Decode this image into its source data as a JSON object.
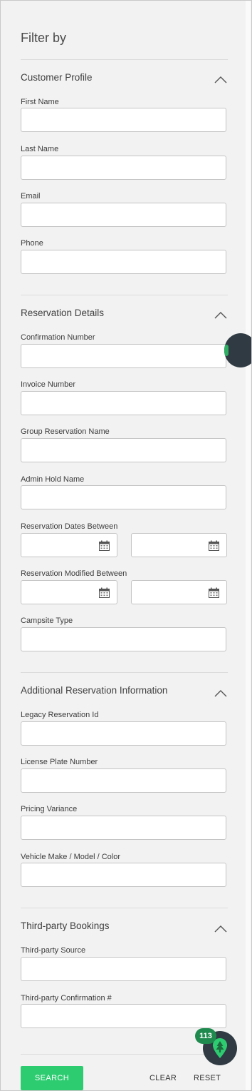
{
  "panel": {
    "title": "Filter by"
  },
  "sections": {
    "customer_profile": {
      "title": "Customer Profile",
      "fields": {
        "first_name": {
          "label": "First Name",
          "value": ""
        },
        "last_name": {
          "label": "Last Name",
          "value": ""
        },
        "email": {
          "label": "Email",
          "value": ""
        },
        "phone": {
          "label": "Phone",
          "value": ""
        }
      }
    },
    "reservation_details": {
      "title": "Reservation Details",
      "fields": {
        "confirmation_number": {
          "label": "Confirmation Number",
          "value": ""
        },
        "invoice_number": {
          "label": "Invoice Number",
          "value": ""
        },
        "group_reservation_name": {
          "label": "Group Reservation Name",
          "value": ""
        },
        "admin_hold_name": {
          "label": "Admin Hold Name",
          "value": ""
        },
        "reservation_dates_between": {
          "label": "Reservation Dates Between",
          "start": "",
          "end": ""
        },
        "reservation_modified_between": {
          "label": "Reservation Modified Between",
          "start": "",
          "end": ""
        },
        "campsite_type": {
          "label": "Campsite Type",
          "value": ""
        }
      }
    },
    "additional_info": {
      "title": "Additional Reservation Information",
      "fields": {
        "legacy_reservation_id": {
          "label": "Legacy Reservation Id",
          "value": ""
        },
        "license_plate_number": {
          "label": "License Plate Number",
          "value": ""
        },
        "pricing_variance": {
          "label": "Pricing Variance",
          "value": ""
        },
        "vehicle": {
          "label": "Vehicle Make / Model / Color",
          "value": ""
        }
      }
    },
    "third_party": {
      "title": "Third-party Bookings",
      "fields": {
        "source": {
          "label": "Third-party Source",
          "value": ""
        },
        "confirmation": {
          "label": "Third-party Confirmation #",
          "value": ""
        }
      }
    }
  },
  "help_widget": {
    "badge": "113",
    "icon": "tree-marker-icon"
  },
  "actions": {
    "search": "SEARCH",
    "clear": "CLEAR",
    "reset": "RESET"
  },
  "colors": {
    "primary": "#2ecc71",
    "badge": "#1f8a4e",
    "dark": "#2f3a42",
    "panel_bg": "#f2f2f2"
  }
}
